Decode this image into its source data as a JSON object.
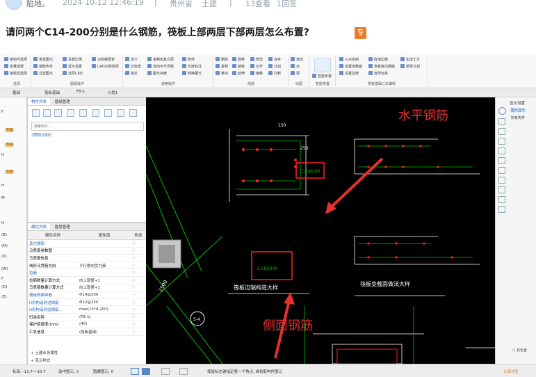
{
  "post_meta": {
    "author": "陷地。",
    "datetime": "2024-10-12 12:46:19",
    "location": "贵州省",
    "category": "土建",
    "views": "13查看",
    "answers": "1回答"
  },
  "question": {
    "title": "请问两个C14-200分别是什么钢筋，筏板上部两层下部两层怎么布置?",
    "badge": "专"
  },
  "ribbon": {
    "groups": [
      {
        "name": "选择",
        "items": [
          "按构件选择",
          "批量选择",
          "按属性选择"
        ]
      },
      {
        "name": "图纸操作",
        "items": [
          "查找图元",
          "拾取构件",
          "过滤图元",
          "设置比例",
          "显示设置",
          "还原CAD",
          "识别楼层表",
          "CAD识别选项"
        ]
      },
      {
        "name": "通用操作",
        "items": [
          "定义",
          "云检查",
          "锁定",
          "复制到其它层",
          "自动平齐顶板",
          "图元存盘",
          "构件",
          "长度标注",
          "转换图元"
        ]
      },
      {
        "name": "修改",
        "items": [
          "删除",
          "复制",
          "移动",
          "旋转",
          "镜像",
          "延伸",
          "修剪",
          "对齐",
          "偏移",
          "合并",
          "分割",
          "打断"
        ]
      },
      {
        "name": "绘图",
        "items": [
          "直线",
          "点",
          "弧"
        ]
      },
      {
        "name": "智能布置",
        "items": [
          "智能布置"
        ]
      },
      {
        "name": "筏板基础二次编辑",
        "items": [
          "三点变斜",
          "设置变截面",
          "设置边坡",
          "取消边坡",
          "查看板内钢筋",
          "查改标高",
          "生成土方",
          "按梁分割"
        ]
      }
    ]
  },
  "breadcrumb": [
    "基础",
    "筏板基础",
    "FB-1",
    "分层1"
  ],
  "left_strip": {
    "items": [
      "(B)",
      "(M)",
      "(K)",
      "(W)",
      "(D)",
      "(E)"
    ],
    "tags": [
      "专属",
      "专属",
      "专属"
    ],
    "letters": [
      "F",
      "H",
      "H",
      "M",
      "H",
      "F"
    ]
  },
  "component_panel": {
    "tabs": [
      "构件列表",
      "图纸管理"
    ],
    "search_placeholder": "搜索构件...",
    "tree_item": "FB-1 <1>"
  },
  "property_panel": {
    "tabs": [
      "属性列表",
      "图层管理"
    ],
    "headers": [
      "属性名称",
      "属性值",
      "附加"
    ],
    "rows": [
      {
        "name": "其它钢筋",
        "value": "",
        "blue": true
      },
      {
        "name": "马凳筋参数图",
        "value": "",
        "blue": false
      },
      {
        "name": "马凳筋信息",
        "value": "",
        "blue": false
      },
      {
        "name": "线形马凳筋方向",
        "value": "平行横向受力筋",
        "blue": false
      },
      {
        "name": "拉筋",
        "value": "",
        "blue": true
      },
      {
        "name": "拉筋数量计算方式",
        "value": "向上取整+1",
        "blue": false
      },
      {
        "name": "马凳筋数量计算方式",
        "value": "向上取整+1",
        "blue": false
      },
      {
        "name": "筏板侧面纵筋",
        "value": "Φ14@200",
        "blue": true
      },
      {
        "name": "U形构造封边钢筋",
        "value": "Φ12@250",
        "blue": true
      },
      {
        "name": "U形构造封边钢筋...",
        "value": "max(15*d,200)",
        "blue": true
      },
      {
        "name": "归类名称",
        "value": "(FB-1)",
        "blue": false
      },
      {
        "name": "保护层厚度(mm)",
        "value": "(40)",
        "blue": false
      },
      {
        "name": "汇总信息",
        "value": "(筏板基础)",
        "blue": false
      }
    ],
    "sections": [
      "土建业务属性",
      "显示样式"
    ]
  },
  "cad": {
    "section_title_1": "筏板边端构造大样",
    "section_title_2": "筏板变截面做法大样",
    "label_box_1": "C14@200",
    "label_box_2": "C14@200",
    "dim_a": "150",
    "dim_b": "250",
    "grid_label": "5-4",
    "dim_c": "2500"
  },
  "annotations": {
    "horizontal": "水平钢筋",
    "side": "侧面钢筋"
  },
  "right_panel": {
    "title": "显示设置",
    "subtitle": "图元显示",
    "items": [
      "所有构件"
    ],
    "checkbox_label": "具包含"
  },
  "status_bar": {
    "coords": "标高: -13.7~-10.7",
    "selected": "选中图元: 0",
    "hidden": "隐藏图元: 0",
    "hint": "按鼠标左键指定第一个角点, 或拾取构件图元",
    "right": "计算排查"
  },
  "colors": {
    "annotation_red": "#e83030",
    "cad_bg": "#000000",
    "cad_green": "#00c000",
    "cad_white": "#ffffff",
    "cad_red": "#ff2020",
    "link_blue": "#1e5fb4",
    "badge_orange": "#f07c2a"
  }
}
